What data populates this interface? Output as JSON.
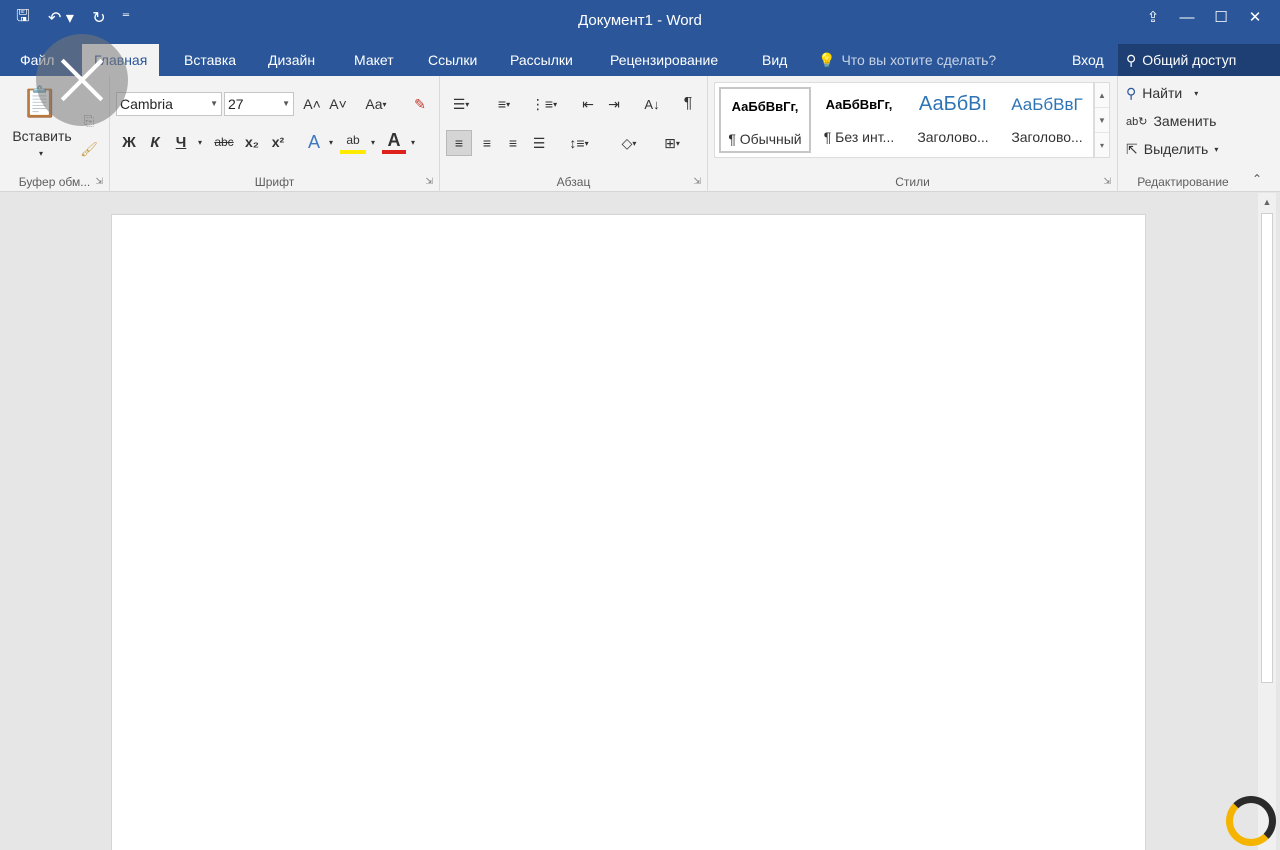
{
  "window": {
    "title": "Документ1 - Word",
    "accent": "#2b579a"
  },
  "qat": [
    {
      "name": "save-icon",
      "glyph": "🖫"
    },
    {
      "name": "undo-icon",
      "glyph": "↶ ▾"
    },
    {
      "name": "redo-icon",
      "glyph": "↻"
    },
    {
      "name": "customize-qat-icon",
      "glyph": "⁼"
    }
  ],
  "window_controls": {
    "ribbon_display": "⇪",
    "minimize": "—",
    "maximize": "☐",
    "close": "✕"
  },
  "tabs": {
    "file": "Файл",
    "home": "Главная",
    "insert": "Вставка",
    "design": "Дизайн",
    "layout": "Макет",
    "references": "Ссылки",
    "mailings": "Рассылки",
    "review": "Рецензирование",
    "view": "Вид"
  },
  "tell_me": "Что вы хотите сделать?",
  "signin": "Вход",
  "share": "Общий доступ",
  "clipboard": {
    "paste": "Вставить",
    "label": "Буфер обм..."
  },
  "font": {
    "name": "Cambria",
    "size": "27",
    "label": "Шрифт",
    "bold": "Ж",
    "italic": "К",
    "underline": "Ч",
    "strike": "abc",
    "subscript": "x₂",
    "superscript": "x²",
    "grow": "A˄",
    "shrink": "A˅",
    "case": "Aa",
    "text_effects": "A",
    "highlight": "ab",
    "font_color": "A"
  },
  "paragraph": {
    "label": "Абзац",
    "pilcrow": "¶",
    "sort": "A↓"
  },
  "styles": {
    "label": "Стили",
    "items": [
      {
        "preview": "АаБбВвГг,",
        "name": "¶ Обычный"
      },
      {
        "preview": "АаБбВвГг,",
        "name": "¶ Без инт..."
      },
      {
        "preview": "АаБбВı",
        "name": "Заголово..."
      },
      {
        "preview": "АаБбВвГ",
        "name": "Заголово..."
      }
    ]
  },
  "editing": {
    "label": "Редактирование",
    "find": "Найти",
    "replace": "Заменить",
    "select": "Выделить"
  }
}
